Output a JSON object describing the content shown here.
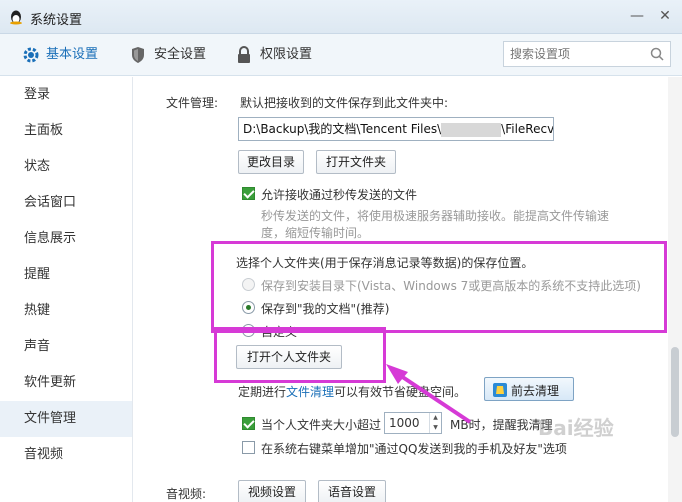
{
  "window": {
    "title": "系统设置"
  },
  "tabs": [
    {
      "label": "基本设置",
      "active": true
    },
    {
      "label": "安全设置"
    },
    {
      "label": "权限设置"
    }
  ],
  "search": {
    "placeholder": "搜索设置项"
  },
  "sidebar": {
    "items": [
      {
        "label": "登录"
      },
      {
        "label": "主面板"
      },
      {
        "label": "状态"
      },
      {
        "label": "会话窗口"
      },
      {
        "label": "信息展示"
      },
      {
        "label": "提醒"
      },
      {
        "label": "热键"
      },
      {
        "label": "声音"
      },
      {
        "label": "软件更新"
      },
      {
        "label": "文件管理",
        "active": true
      },
      {
        "label": "音视频"
      }
    ]
  },
  "file_mgmt": {
    "section_label": "文件管理:",
    "desc": "默认把接收到的文件保存到此文件夹中:",
    "path_prefix": "D:\\Backup\\我的文档\\Tencent Files\\",
    "path_suffix": "\\FileRecv\\",
    "change_dir_label": "更改目录",
    "open_folder_label": "打开文件夹",
    "allow_fast_label": "允许接收通过秒传发送的文件",
    "allow_fast_checked": true,
    "fast_desc_line1": "秒传发送的文件，将使用极速服务器辅助接收。能提高文件传输速",
    "fast_desc_line2": "度，缩短传输时间。",
    "personal_title": "选择个人文件夹(用于保存消息记录等数据)的保存位置。",
    "option_install": "保存到安装目录下(Vista、Windows 7或更高版本的系统不支持此选项)",
    "option_mydocs": "保存到\"我的文档\"(推荐)",
    "option_custom": "自定义",
    "selected_option": "option_mydocs",
    "open_personal_label": "打开个人文件夹",
    "cleanup_prefix": "定期进行",
    "cleanup_link": "文件清理",
    "cleanup_suffix": "可以有效节省硬盘空间。",
    "clean_btn_label": "前去清理",
    "size_prefix": "当个人文件夹大小超过",
    "size_value": "1000",
    "size_suffix": "MB时，提醒我清理",
    "size_checked": true,
    "context_menu_label": "在系统右键菜单增加\"通过QQ发送到我的手机及好友\"选项",
    "context_menu_checked": false
  },
  "av": {
    "section_label": "音视频:",
    "video_btn_label": "视频设置",
    "voice_btn_label": "语音设置"
  },
  "watermark": "Bai经验",
  "colors": {
    "highlight": "#d63ad6",
    "accent": "#1a6fb8",
    "check": "#3a9e3a"
  },
  "icons": [
    "qq-penguin-icon",
    "gear-icon",
    "shield-icon",
    "lock-icon",
    "search-icon",
    "minimize-icon",
    "close-icon",
    "broom-icon"
  ]
}
